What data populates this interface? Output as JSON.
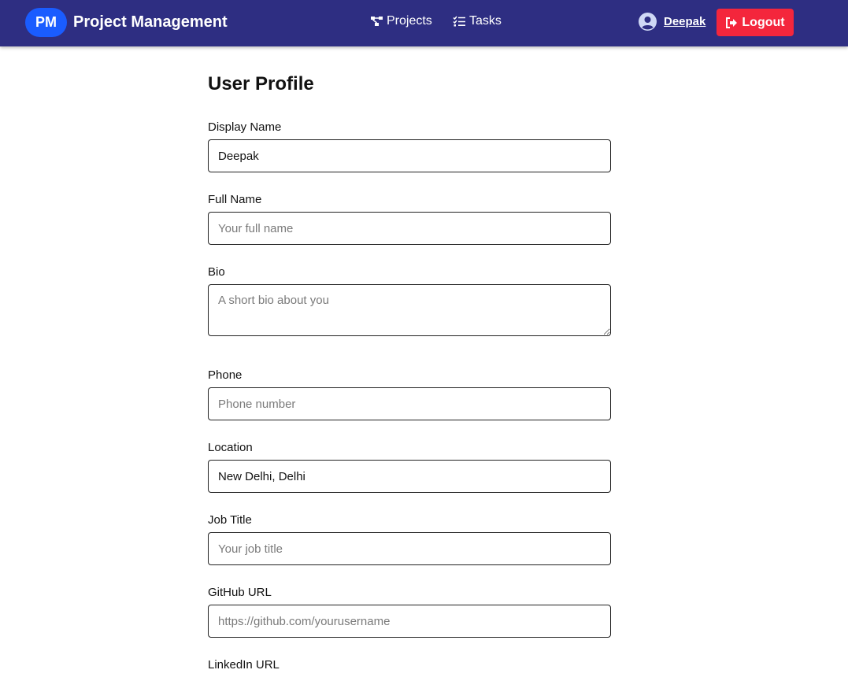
{
  "nav": {
    "logo": "PM",
    "title": "Project Management",
    "projects_label": "Projects",
    "tasks_label": "Tasks",
    "user_name": "Deepak",
    "logout_label": "Logout",
    "colors": {
      "navbar": "#2e2e82",
      "logo_badge": "#1a5cff",
      "logout": "#f4263c"
    },
    "icons": {
      "projects": "sitemap-icon",
      "tasks": "checklist-icon",
      "user": "user-circle-icon",
      "logout": "sign-out-icon"
    }
  },
  "profile": {
    "title": "User Profile",
    "fields": {
      "display_name": {
        "label": "Display Name",
        "value": "Deepak",
        "placeholder": ""
      },
      "full_name": {
        "label": "Full Name",
        "value": "",
        "placeholder": "Your full name"
      },
      "bio": {
        "label": "Bio",
        "value": "",
        "placeholder": "A short bio about you"
      },
      "phone": {
        "label": "Phone",
        "value": "",
        "placeholder": "Phone number"
      },
      "location": {
        "label": "Location",
        "value": "New Delhi, Delhi",
        "placeholder": ""
      },
      "job_title": {
        "label": "Job Title",
        "value": "",
        "placeholder": "Your job title"
      },
      "github_url": {
        "label": "GitHub URL",
        "value": "",
        "placeholder": "https://github.com/yourusername"
      },
      "linkedin_url": {
        "label": "LinkedIn URL"
      }
    }
  }
}
